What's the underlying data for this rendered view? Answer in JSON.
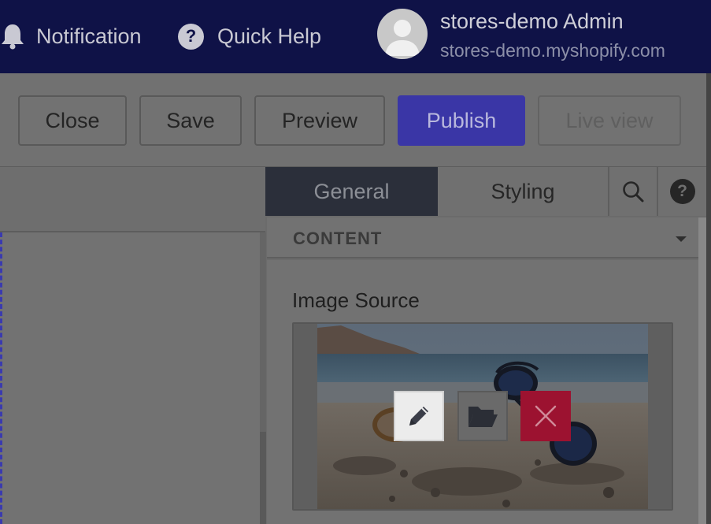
{
  "header": {
    "notification_label": "Notification",
    "help_label": "Quick Help",
    "user_name": "stores-demo Admin",
    "store_domain": "stores-demo.myshopify.com"
  },
  "toolbar": {
    "close_label": "Close",
    "save_label": "Save",
    "preview_label": "Preview",
    "publish_label": "Publish",
    "live_view_label": "Live view"
  },
  "panel": {
    "tabs": [
      {
        "label": "General",
        "active": true
      },
      {
        "label": "Styling",
        "active": false
      }
    ],
    "search_icon": "search-icon",
    "help_icon": "question-circle-icon",
    "section_title": "CONTENT",
    "image_source_label": "Image Source",
    "image_actions": [
      {
        "icon": "pencil-icon",
        "action": "edit"
      },
      {
        "icon": "folder-open-icon",
        "action": "browse"
      },
      {
        "icon": "close-icon",
        "action": "delete"
      }
    ]
  },
  "colors": {
    "header_bg": "#0f1247",
    "publish_bg": "#3a36a6",
    "active_tab_bg": "#2b2f3a",
    "delete_bg": "#9c1230",
    "canvas_outline": "#3a3ab0"
  }
}
